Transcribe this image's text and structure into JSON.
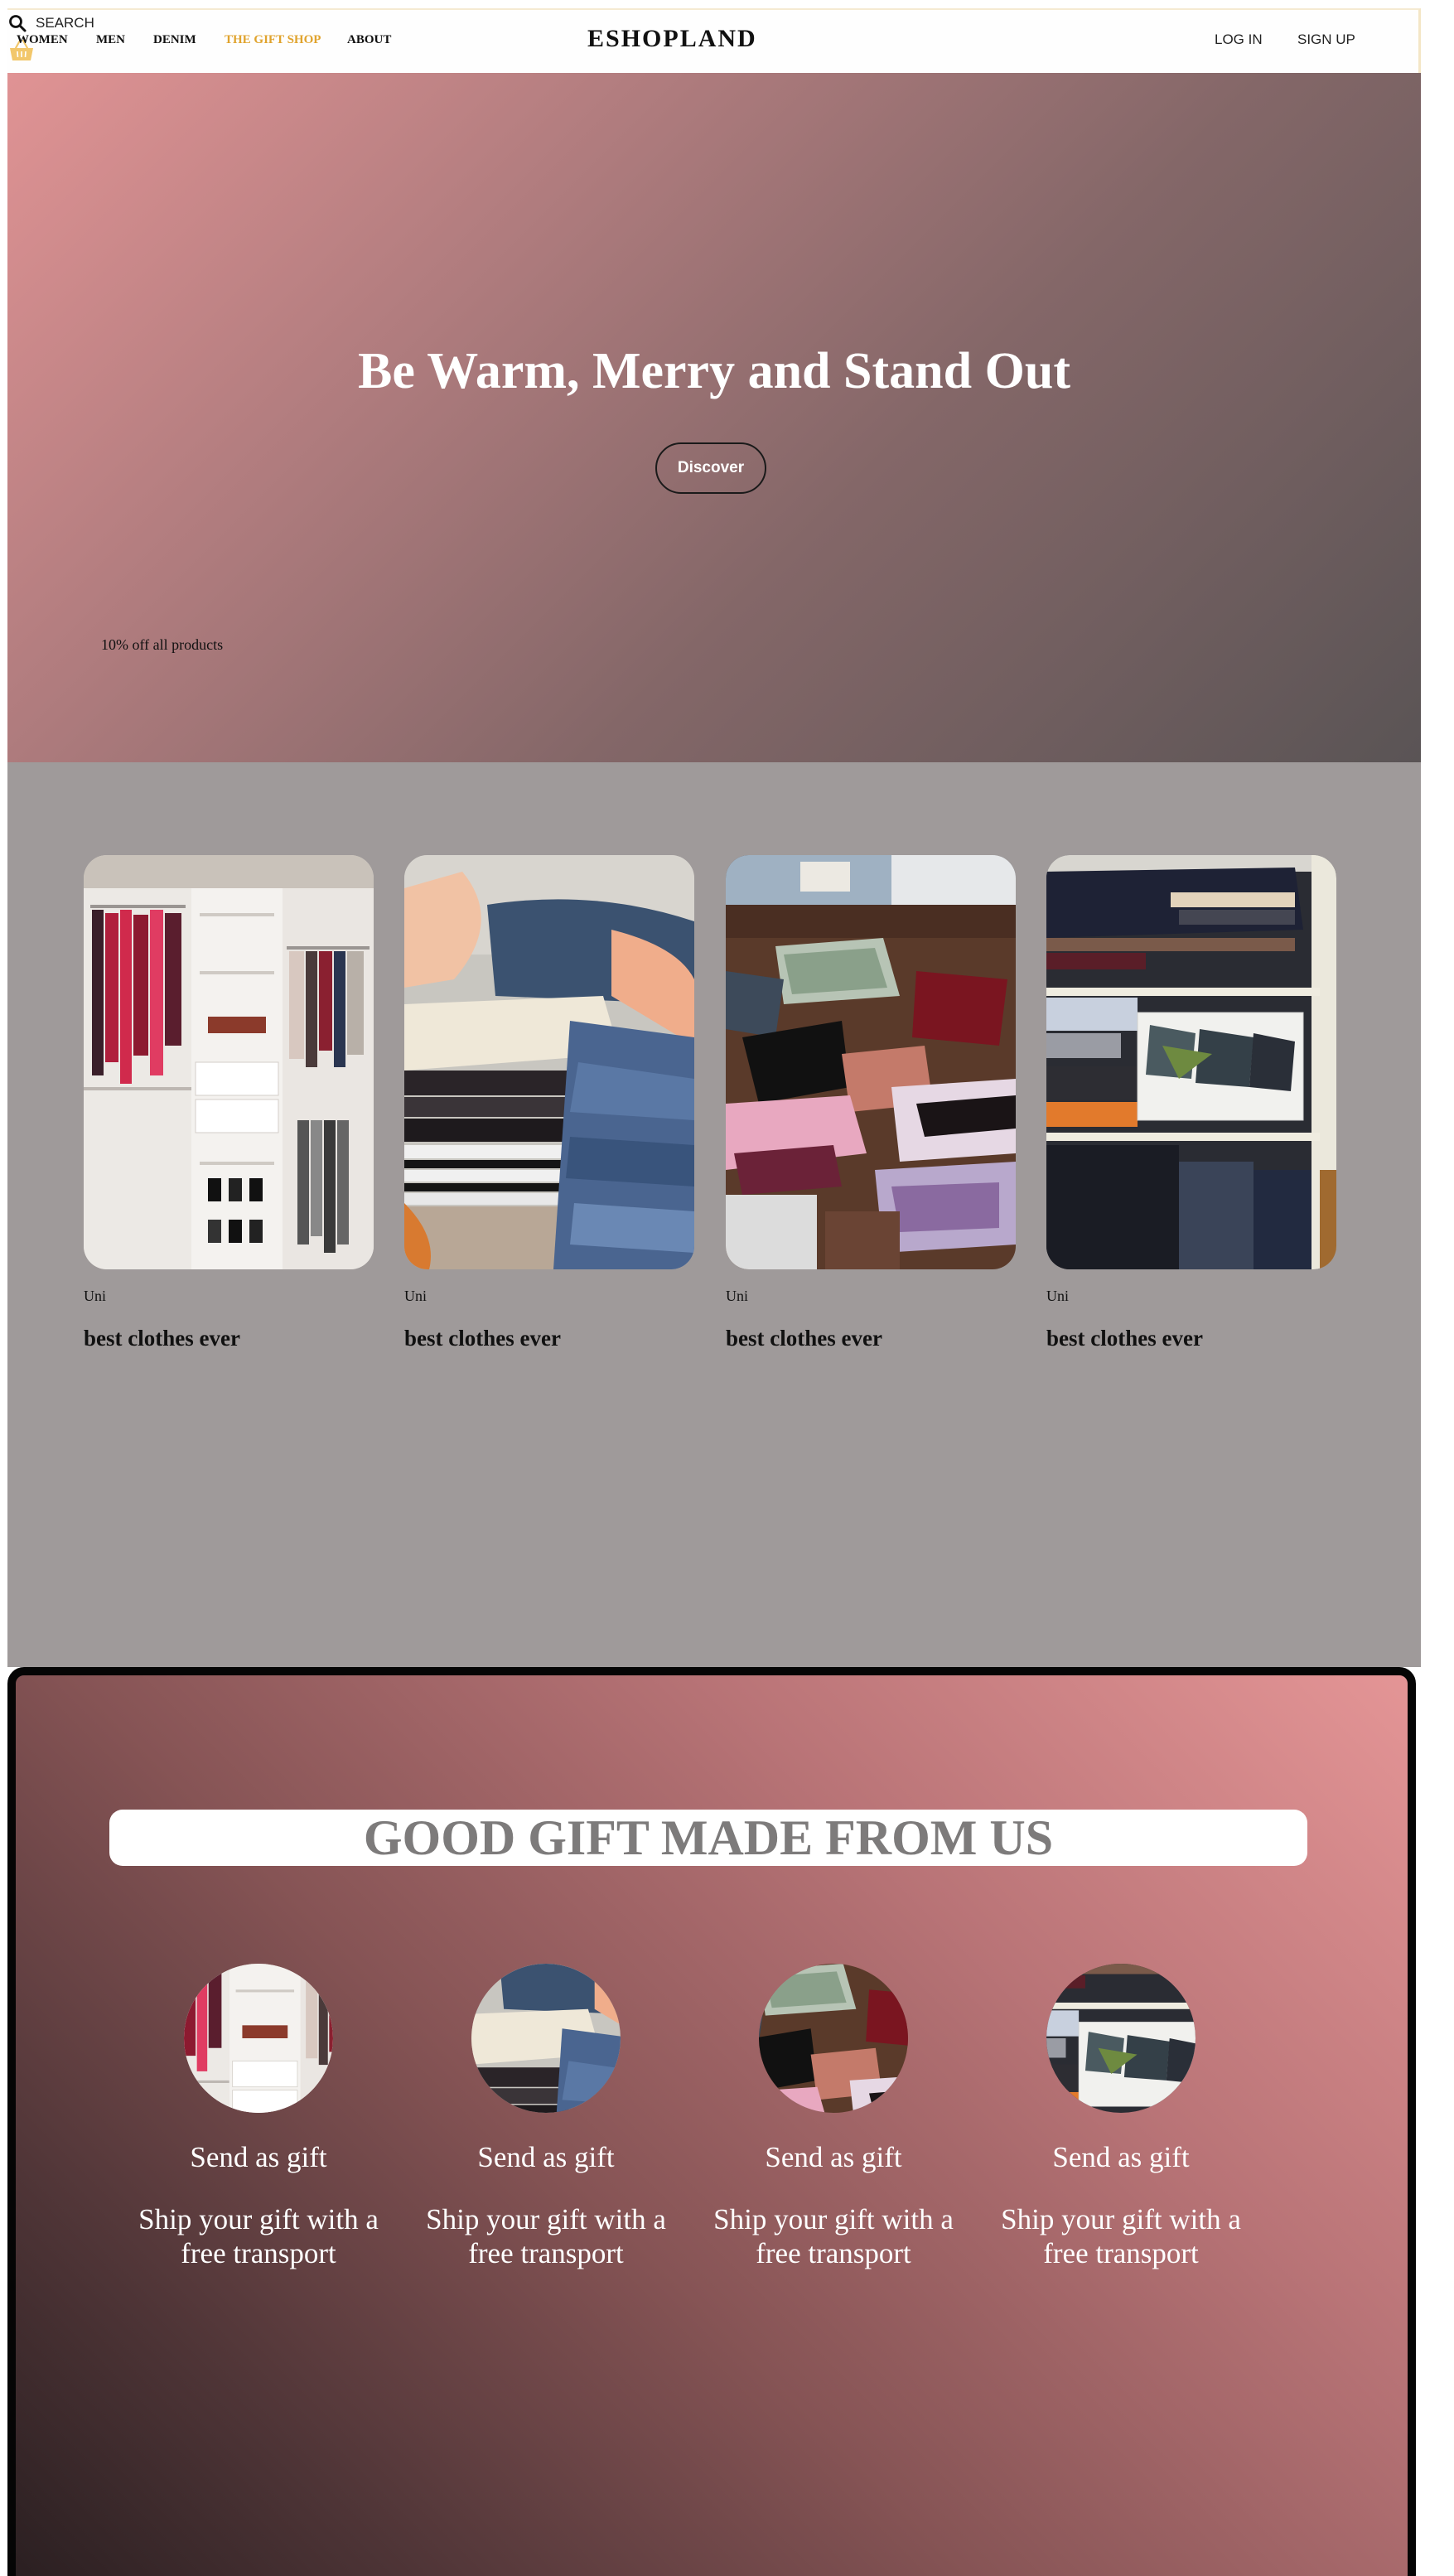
{
  "nav": {
    "links": [
      "WOMEN",
      "MEN",
      "DENIM",
      "THE GIFT SHOP",
      "ABOUT"
    ],
    "brand": "ESHOPLAND",
    "search_label": "SEARCH",
    "login": "LOG IN",
    "signup": "SIGN UP",
    "cart_icon": "basket-icon",
    "search_icon": "search-icon",
    "highlight_color": "#e0a32d"
  },
  "hero": {
    "title": "Be Warm, Merry and Stand Out",
    "button": "Discover",
    "promo": "10% off all products"
  },
  "products": [
    {
      "category": "Uni",
      "title": "best clothes ever",
      "image": "closet-with-hanging-clothes"
    },
    {
      "category": "Uni",
      "title": "best clothes ever",
      "image": "folding-jeans-and-sweaters"
    },
    {
      "category": "Uni",
      "title": "best clothes ever",
      "image": "folded-laundry-on-counter"
    },
    {
      "category": "Uni",
      "title": "best clothes ever",
      "image": "shelves-with-folded-clothes"
    }
  ],
  "gift": {
    "heading": "GOOD GIFT MADE FROM US",
    "items": [
      {
        "title": "Send as gift",
        "desc": "Ship your gift with a free transport"
      },
      {
        "title": "Send as gift",
        "desc": "Ship your gift with a free transport"
      },
      {
        "title": "Send as gift",
        "desc": "Ship your gift with a free transport"
      },
      {
        "title": "Send as gift",
        "desc": "Ship your gift with a free transport"
      }
    ]
  }
}
